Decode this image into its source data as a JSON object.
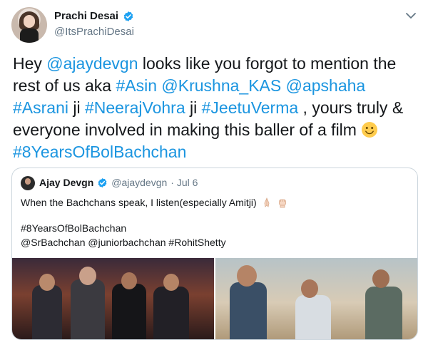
{
  "tweet": {
    "author": {
      "name": "Prachi Desai",
      "handle": "@ItsPrachiDesai",
      "verified": true
    },
    "text_parts": [
      {
        "t": "Hey ",
        "link": false
      },
      {
        "t": "@ajaydevgn",
        "link": true
      },
      {
        "t": "  looks like you forgot to mention the rest of us aka  ",
        "link": false
      },
      {
        "t": "#Asin",
        "link": true
      },
      {
        "t": " ",
        "link": false
      },
      {
        "t": "@Krushna_KAS",
        "link": true
      },
      {
        "t": " ",
        "link": false
      },
      {
        "t": "@apshaha",
        "link": true
      },
      {
        "t": " ",
        "link": false
      },
      {
        "t": "#Asrani",
        "link": true
      },
      {
        "t": " ji ",
        "link": false
      },
      {
        "t": "#NeerajVohra",
        "link": true
      },
      {
        "t": " ji ",
        "link": false
      },
      {
        "t": "#JeetuVerma",
        "link": true
      },
      {
        "t": " , yours truly & everyone involved in making this baller of a film ",
        "link": false
      },
      {
        "t": "emoji:slightly-smiling-face",
        "link": false
      },
      {
        "t": "\n",
        "link": false
      },
      {
        "t": "#8YearsOfBolBachchan",
        "link": true
      }
    ]
  },
  "quoted": {
    "author": {
      "name": "Ajay Devgn",
      "handle": "@ajaydevgn",
      "date": "· Jul 6",
      "verified": true
    },
    "line1": "When the Bachchans speak, I listen(especially Amitji)",
    "line1_emojis": [
      "folded-hands-icon",
      "raised-fist-icon"
    ],
    "line2": "#8YearsOfBolBachchan",
    "line3": "@SrBachchan @juniorbachchan #RohitShetty",
    "media": [
      "group-photo",
      "cast-on-set-photo"
    ]
  },
  "colors": {
    "link": "#1b95e0",
    "secondary": "#657786",
    "verified": "#1da1f2",
    "border": "#ccd6dd"
  }
}
